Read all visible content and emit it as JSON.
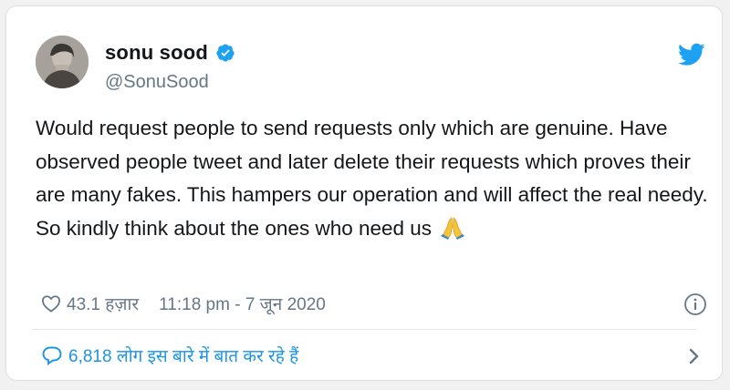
{
  "author": {
    "display_name": "sonu sood",
    "handle": "@SonuSood",
    "verified": true,
    "avatar_icon": "profile-photo"
  },
  "tweet": {
    "text": "Would request people to send requests only which are genuine. Have observed people tweet and later delete their requests which proves their are many fakes. This hampers our operation and will affect the real needy. So kindly think about the ones who need us",
    "emoji": "folded-hands"
  },
  "meta": {
    "likes": "43.1 हज़ार",
    "timestamp": "11:18 pm - 7 जून 2020"
  },
  "footer": {
    "conversation_label": "6,818 लोग इस बारे में बात कर रहे हैं"
  },
  "colors": {
    "accent_blue": "#1da1f2",
    "link_blue": "#1b95e0",
    "text_primary": "#14171a",
    "text_secondary": "#657786"
  }
}
